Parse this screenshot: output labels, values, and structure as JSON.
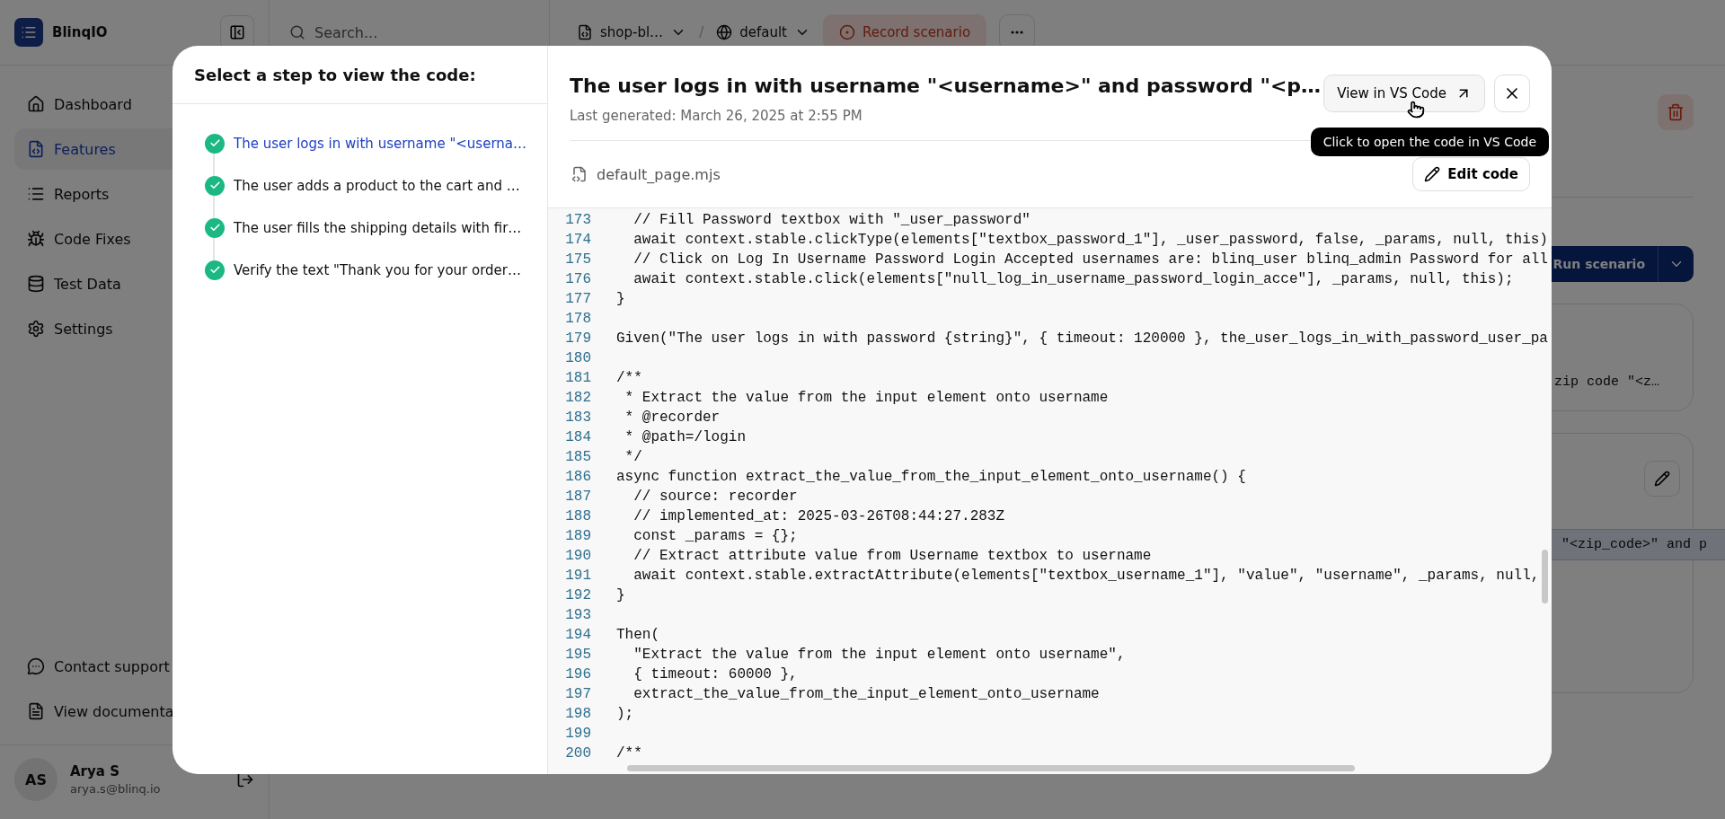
{
  "app": {
    "logo": "BlinqIO"
  },
  "search": {
    "placeholder": "Search..."
  },
  "breadcrumb": {
    "project": "shop-bl…",
    "separator": "/",
    "environment": "default"
  },
  "record_button": "Record scenario",
  "nav": [
    {
      "label": "Dashboard",
      "selected": false
    },
    {
      "label": "Features",
      "selected": true
    },
    {
      "label": "Reports",
      "selected": false
    },
    {
      "label": "Code Fixes",
      "selected": false
    },
    {
      "label": "Test Data",
      "selected": false
    },
    {
      "label": "Settings",
      "selected": false
    }
  ],
  "footer_links": [
    "Contact support",
    "View documenta"
  ],
  "user": {
    "initials": "AS",
    "name": "Arya S",
    "email": "arya.s@blinq.io"
  },
  "run_button": "Run scenario",
  "background_cards": [
    {
      "text": "zip code \"<z…",
      "highlighted": false,
      "editable": false
    },
    {
      "text": "\"<zip_code>\" and p",
      "highlighted": true,
      "editable": true
    }
  ],
  "modal": {
    "steps_heading": "Select a step to view the code:",
    "steps": [
      {
        "label": "The user logs in with username \"<userna…",
        "selected": true,
        "done": true
      },
      {
        "label": "The user adds a product to the cart and …",
        "selected": false,
        "done": true
      },
      {
        "label": "The user fills the shipping details with fir…",
        "selected": false,
        "done": true
      },
      {
        "label": "Verify the text \"Thank you for your order…",
        "selected": false,
        "done": true
      }
    ],
    "title": "The user logs in with username \"<username>\" and password \"<p…",
    "last_generated": "Last generated: March 26, 2025 at 2:55 PM",
    "vscode_button": "View in VS Code",
    "tooltip": "Click to open the code in VS Code",
    "file_name": "default_page.mjs",
    "edit_button": "Edit code",
    "code_lines": [
      {
        "number": "173",
        "text": "  // Fill Password textbox with \"_user_password\""
      },
      {
        "number": "174",
        "text": "  await context.stable.clickType(elements[\"textbox_password_1\"], _user_password, false, _params, null, this)"
      },
      {
        "number": "175",
        "text": "  // Click on Log In Username Password Login Accepted usernames are: blinq_user blinq_admin Password for all"
      },
      {
        "number": "176",
        "text": "  await context.stable.click(elements[\"null_log_in_username_password_login_acce\"], _params, null, this);"
      },
      {
        "number": "177",
        "text": "}"
      },
      {
        "number": "178"
      },
      {
        "number": "179",
        "text": "Given(\"The user logs in with password {string}\", { timeout: 120000 }, the_user_logs_in_with_password_user_pa"
      },
      {
        "number": "180"
      },
      {
        "number": "181",
        "text": "/**"
      },
      {
        "number": "182",
        "text": " * Extract the value from the input element onto username"
      },
      {
        "number": "183",
        "text": " * @recorder"
      },
      {
        "number": "184",
        "text": " * @path=/login"
      },
      {
        "number": "185",
        "text": " */"
      },
      {
        "number": "186",
        "text": "async function extract_the_value_from_the_input_element_onto_username() {"
      },
      {
        "number": "187",
        "text": "  // source: recorder"
      },
      {
        "number": "188",
        "text": "  // implemented_at: 2025-03-26T08:44:27.283Z"
      },
      {
        "number": "189",
        "text": "  const _params = {};"
      },
      {
        "number": "190",
        "text": "  // Extract attribute value from Username textbox to username"
      },
      {
        "number": "191",
        "text": "  await context.stable.extractAttribute(elements[\"textbox_username_1\"], \"value\", \"username\", _params, null,"
      },
      {
        "number": "192",
        "text": "}"
      },
      {
        "number": "193"
      },
      {
        "number": "194",
        "text": "Then("
      },
      {
        "number": "195",
        "text": "  \"Extract the value from the input element onto username\","
      },
      {
        "number": "196",
        "text": "  { timeout: 60000 },"
      },
      {
        "number": "197",
        "text": "  extract_the_value_from_the_input_element_onto_username"
      },
      {
        "number": "198",
        "text": ");"
      },
      {
        "number": "199"
      },
      {
        "number": "200",
        "text": "/**"
      }
    ]
  }
}
